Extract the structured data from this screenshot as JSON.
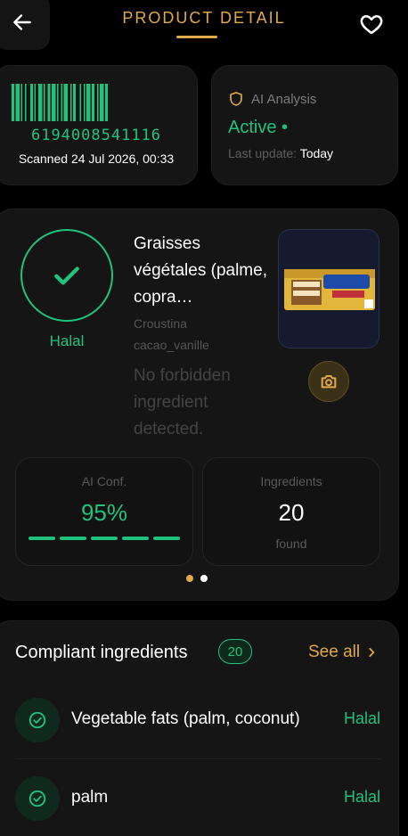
{
  "header": {
    "title": "PRODUCT DETAIL",
    "accent_color": "#e0a94a",
    "back_icon": "arrow-left-icon",
    "favorite_icon": "heart-outline-icon"
  },
  "barcode": {
    "number": "6194008541116",
    "scanned": "Scanned 24 Jul 2026, 00:33",
    "color": "#1fc37e"
  },
  "ai_analysis": {
    "icon": "shield-icon",
    "label": "AI Analysis",
    "status": "Active •",
    "last_update_label": "Last update:",
    "last_update_value": "Today"
  },
  "product": {
    "verdict_icon": "checkmark-icon",
    "verdict": "Halal",
    "name": "Graisses végétales (palme, copra…",
    "brand_line1": "Croustina",
    "brand_line2": "cacao_vanille",
    "message": "No forbidden ingredient detected.",
    "image_icon": "product-image",
    "camera_icon": "camera-icon"
  },
  "stats": {
    "confidence": {
      "label": "AI Conf.",
      "value": "95%",
      "level": 0.95
    },
    "ingredients": {
      "label": "Ingredients",
      "value": "20",
      "sub": "found"
    }
  },
  "pager": {
    "pages": 2,
    "active": 0
  },
  "ingredients_section": {
    "title": "Compliant ingredients",
    "count": "20",
    "see_all": "See all",
    "see_all_icon": "chevron-right-icon",
    "items": [
      {
        "name": "Vegetable fats (palm, coconut)",
        "status": "Halal",
        "icon": "check-circle-icon"
      },
      {
        "name": "palm",
        "status": "Halal",
        "icon": "check-circle-icon"
      }
    ]
  }
}
